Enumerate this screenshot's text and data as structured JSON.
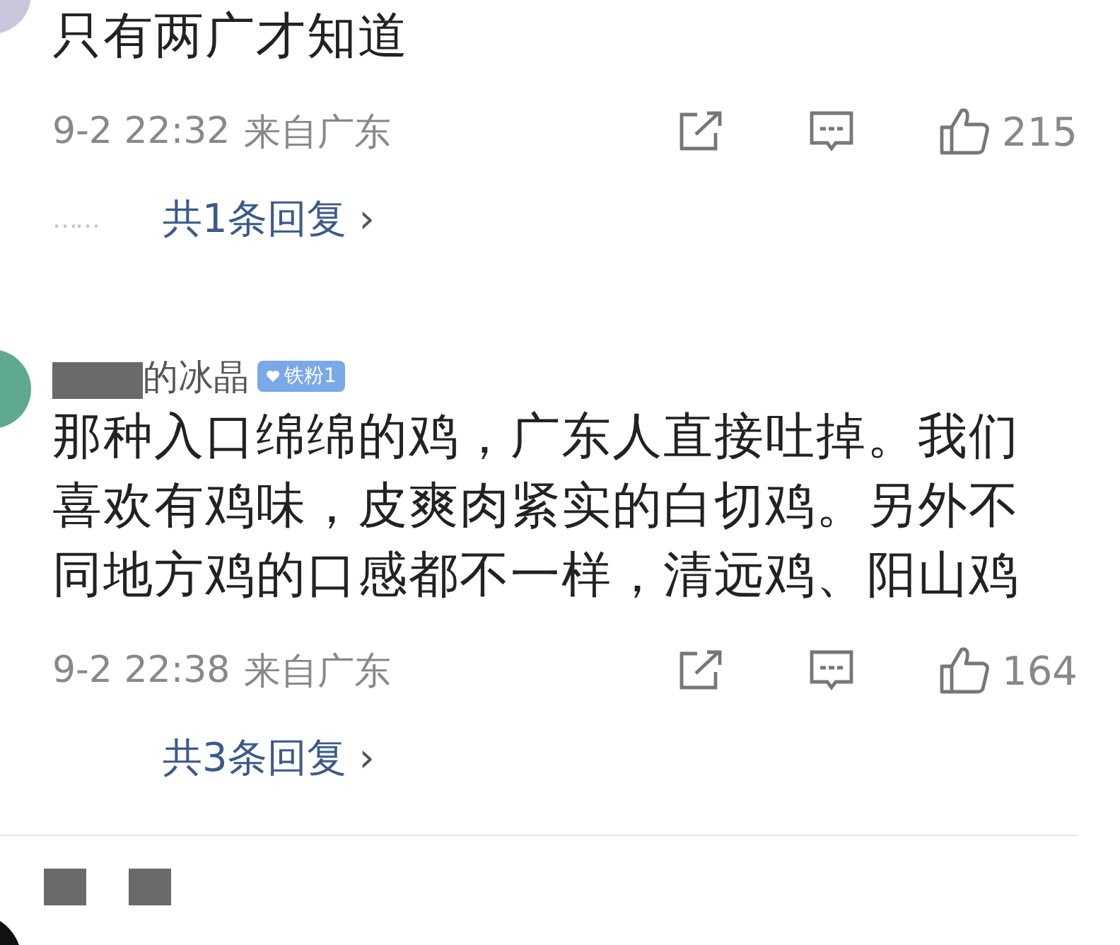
{
  "comments": [
    {
      "text": "只有两广才知道",
      "time": "9-2 22:32",
      "location": "来自广东",
      "likes": "215",
      "replies": "共1条回复",
      "dots": "……",
      "arrow": "›"
    },
    {
      "username": "的冰晶",
      "badge": "铁粉1",
      "text": "那种入口绵绵的鸡，广东人直接吐掉。我们喜欢有鸡味，皮爽肉紧实的白切鸡。另外不同地方鸡的口感都不一样，清远鸡、阳山鸡",
      "time": "9-2 22:38",
      "location": "来自广东",
      "likes": "164",
      "replies": "共3条回复",
      "arrow": "›"
    },
    {
      "kind": "hidden"
    }
  ]
}
